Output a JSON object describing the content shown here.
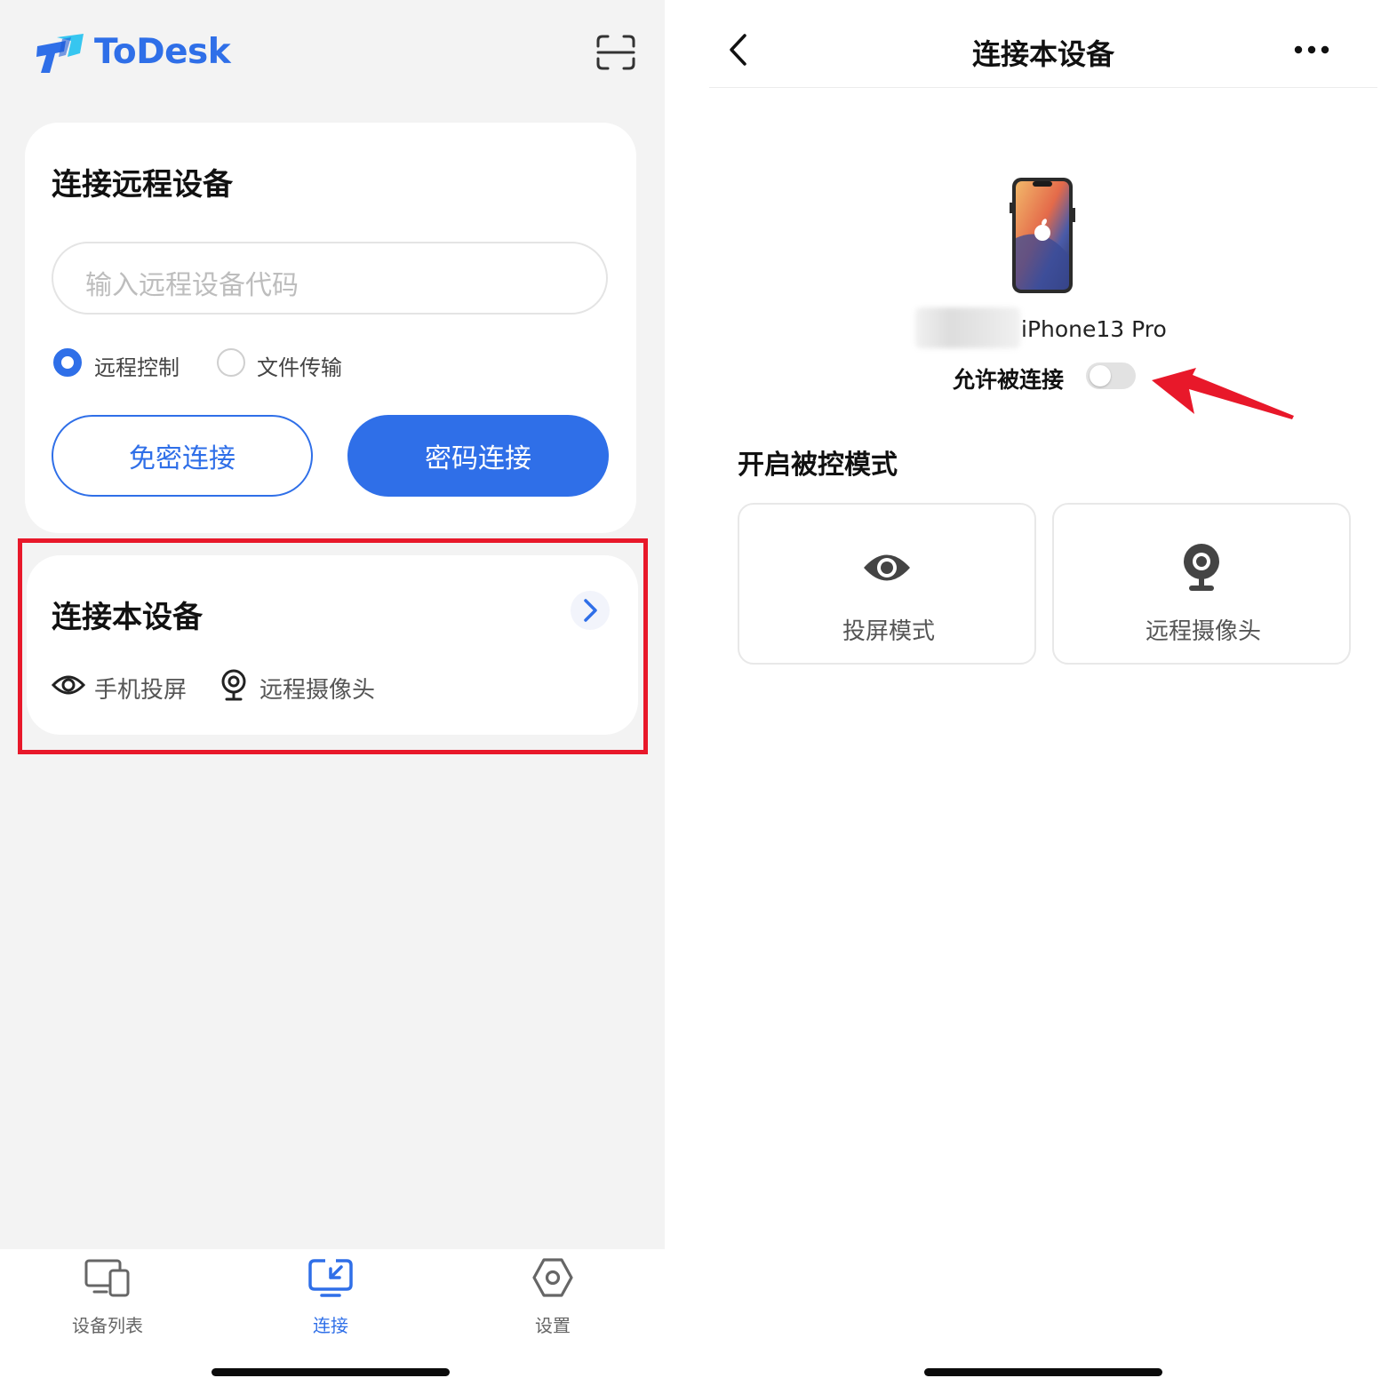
{
  "left": {
    "app_name": "ToDesk",
    "card_remote": {
      "title": "连接远程设备",
      "input_placeholder": "输入远程设备代码",
      "options": [
        "远程控制",
        "文件传输"
      ],
      "selected_option": "远程控制",
      "btn_nopass": "免密连接",
      "btn_pass": "密码连接"
    },
    "card_local": {
      "title": "连接本设备",
      "opt_screen": "手机投屏",
      "opt_camera": "远程摄像头"
    },
    "tabs": [
      {
        "label": "设备列表",
        "active": false
      },
      {
        "label": "连接",
        "active": true
      },
      {
        "label": "设置",
        "active": false
      }
    ]
  },
  "right": {
    "title": "连接本设备",
    "device_name": "iPhone13 Pro",
    "allow_label": "允许被连接",
    "allow_enabled": false,
    "section_title": "开启被控模式",
    "modes": [
      {
        "label": "投屏模式",
        "icon": "eye-icon"
      },
      {
        "label": "远程摄像头",
        "icon": "webcam-icon"
      }
    ]
  },
  "colors": {
    "accent": "#2f6fe8",
    "highlight": "#e8182a"
  }
}
